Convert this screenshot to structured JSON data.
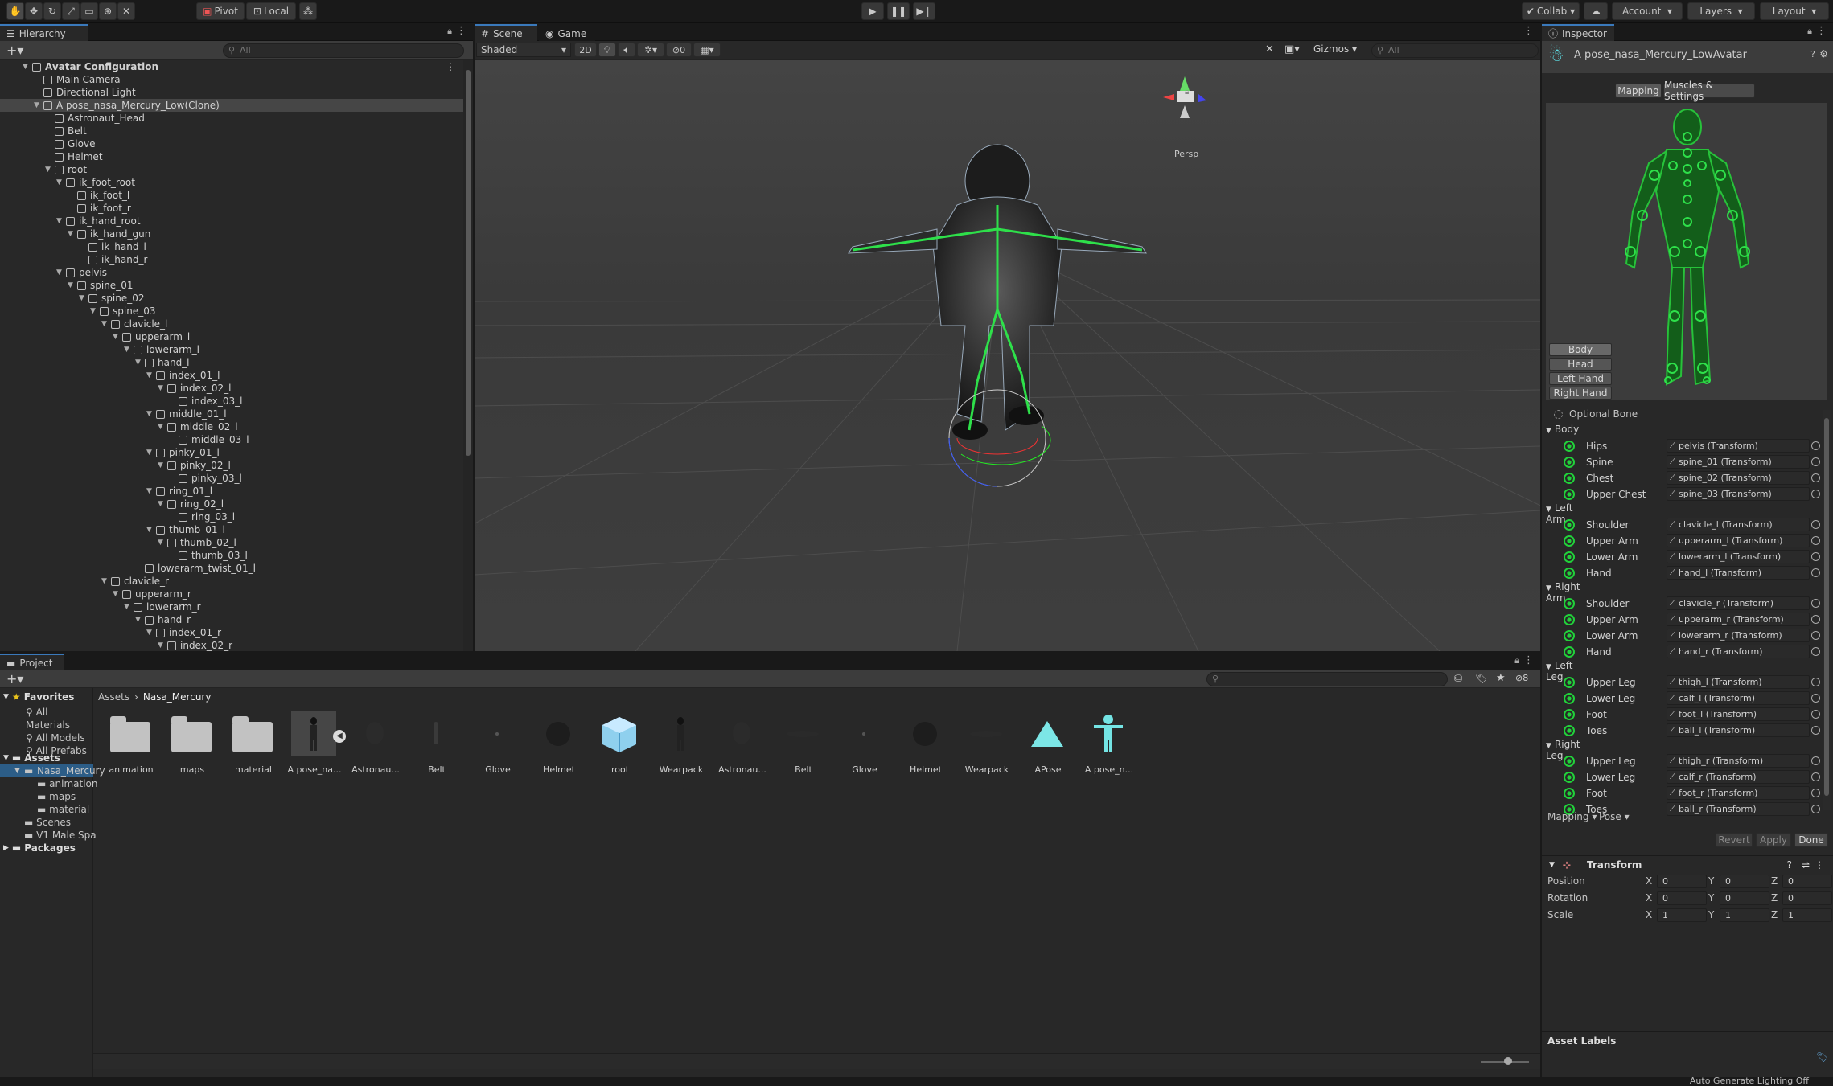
{
  "toolbar": {
    "pivot": "Pivot",
    "local": "Local",
    "collab": "Collab",
    "account": "Account",
    "layers": "Layers",
    "layout": "Layout"
  },
  "hierarchy": {
    "title": "Hierarchy",
    "search_placeholder": "All",
    "rows": [
      {
        "label": "Avatar Configuration",
        "depth": 0,
        "tri": "▼",
        "bold": true,
        "scene": true
      },
      {
        "label": "Main Camera",
        "depth": 1,
        "tri": ""
      },
      {
        "label": "Directional Light",
        "depth": 1,
        "tri": ""
      },
      {
        "label": "A pose_nasa_Mercury_Low(Clone)",
        "depth": 1,
        "tri": "▼",
        "selected": true
      },
      {
        "label": "Astronaut_Head",
        "depth": 2,
        "tri": ""
      },
      {
        "label": "Belt",
        "depth": 2,
        "tri": ""
      },
      {
        "label": "Glove",
        "depth": 2,
        "tri": ""
      },
      {
        "label": "Helmet",
        "depth": 2,
        "tri": ""
      },
      {
        "label": "root",
        "depth": 2,
        "tri": "▼"
      },
      {
        "label": "ik_foot_root",
        "depth": 3,
        "tri": "▼"
      },
      {
        "label": "ik_foot_l",
        "depth": 4,
        "tri": ""
      },
      {
        "label": "ik_foot_r",
        "depth": 4,
        "tri": ""
      },
      {
        "label": "ik_hand_root",
        "depth": 3,
        "tri": "▼"
      },
      {
        "label": "ik_hand_gun",
        "depth": 4,
        "tri": "▼"
      },
      {
        "label": "ik_hand_l",
        "depth": 5,
        "tri": ""
      },
      {
        "label": "ik_hand_r",
        "depth": 5,
        "tri": ""
      },
      {
        "label": "pelvis",
        "depth": 3,
        "tri": "▼"
      },
      {
        "label": "spine_01",
        "depth": 4,
        "tri": "▼"
      },
      {
        "label": "spine_02",
        "depth": 5,
        "tri": "▼"
      },
      {
        "label": "spine_03",
        "depth": 6,
        "tri": "▼"
      },
      {
        "label": "clavicle_l",
        "depth": 7,
        "tri": "▼"
      },
      {
        "label": "upperarm_l",
        "depth": 8,
        "tri": "▼"
      },
      {
        "label": "lowerarm_l",
        "depth": 9,
        "tri": "▼"
      },
      {
        "label": "hand_l",
        "depth": 10,
        "tri": "▼"
      },
      {
        "label": "index_01_l",
        "depth": 11,
        "tri": "▼"
      },
      {
        "label": "index_02_l",
        "depth": 12,
        "tri": "▼"
      },
      {
        "label": "index_03_l",
        "depth": 13,
        "tri": ""
      },
      {
        "label": "middle_01_l",
        "depth": 11,
        "tri": "▼"
      },
      {
        "label": "middle_02_l",
        "depth": 12,
        "tri": "▼"
      },
      {
        "label": "middle_03_l",
        "depth": 13,
        "tri": ""
      },
      {
        "label": "pinky_01_l",
        "depth": 11,
        "tri": "▼"
      },
      {
        "label": "pinky_02_l",
        "depth": 12,
        "tri": "▼"
      },
      {
        "label": "pinky_03_l",
        "depth": 13,
        "tri": ""
      },
      {
        "label": "ring_01_l",
        "depth": 11,
        "tri": "▼"
      },
      {
        "label": "ring_02_l",
        "depth": 12,
        "tri": "▼"
      },
      {
        "label": "ring_03_l",
        "depth": 13,
        "tri": ""
      },
      {
        "label": "thumb_01_l",
        "depth": 11,
        "tri": "▼"
      },
      {
        "label": "thumb_02_l",
        "depth": 12,
        "tri": "▼"
      },
      {
        "label": "thumb_03_l",
        "depth": 13,
        "tri": ""
      },
      {
        "label": "lowerarm_twist_01_l",
        "depth": 10,
        "tri": ""
      },
      {
        "label": "clavicle_r",
        "depth": 7,
        "tri": "▼"
      },
      {
        "label": "upperarm_r",
        "depth": 8,
        "tri": "▼"
      },
      {
        "label": "lowerarm_r",
        "depth": 9,
        "tri": "▼"
      },
      {
        "label": "hand_r",
        "depth": 10,
        "tri": "▼"
      },
      {
        "label": "index_01_r",
        "depth": 11,
        "tri": "▼"
      },
      {
        "label": "index_02_r",
        "depth": 12,
        "tri": "▼"
      }
    ]
  },
  "scene": {
    "tab_scene": "Scene",
    "tab_game": "Game",
    "shading": "Shaded",
    "mode2d": "2D",
    "hidden_count": "0",
    "gizmos": "Gizmos",
    "search_placeholder": "All",
    "persp": "Persp"
  },
  "project": {
    "title": "Project",
    "favorites": "Favorites",
    "fav_items": [
      "All Materials",
      "All Models",
      "All Prefabs"
    ],
    "assets": "Assets",
    "tree": [
      "Nasa_Mercury",
      "animation",
      "maps",
      "material",
      "Scenes",
      "V1 Male Spa"
    ],
    "packages": "Packages",
    "breadcrumb": [
      "Assets",
      "Nasa_Mercury"
    ],
    "hidden_count": "8",
    "items": [
      {
        "label": "animation",
        "kind": "folder"
      },
      {
        "label": "maps",
        "kind": "folder"
      },
      {
        "label": "material",
        "kind": "folder"
      },
      {
        "label": "A pose_na...",
        "kind": "figure",
        "selected": true
      },
      {
        "label": "Astronau...",
        "kind": "head"
      },
      {
        "label": "Belt",
        "kind": "small"
      },
      {
        "label": "Glove",
        "kind": "dot"
      },
      {
        "label": "Helmet",
        "kind": "ball"
      },
      {
        "label": "root",
        "kind": "box"
      },
      {
        "label": "Wearpack",
        "kind": "figure"
      },
      {
        "label": "Astronau...",
        "kind": "head"
      },
      {
        "label": "Belt",
        "kind": "flat"
      },
      {
        "label": "Glove",
        "kind": "dot"
      },
      {
        "label": "Helmet",
        "kind": "ball"
      },
      {
        "label": "Wearpack",
        "kind": "flat"
      },
      {
        "label": "APose",
        "kind": "apose"
      },
      {
        "label": "A pose_n...",
        "kind": "avatar"
      }
    ]
  },
  "inspector": {
    "title": "Inspector",
    "object_name": "A pose_nasa_Mercury_LowAvatar",
    "tab_mapping": "Mapping",
    "tab_muscles": "Muscles & Settings",
    "body_buttons": [
      "Body",
      "Head",
      "Left Hand",
      "Right Hand"
    ],
    "optional_bone": "Optional Bone",
    "groups": [
      {
        "name": "Body",
        "bones": [
          [
            "Hips",
            "pelvis (Transform)"
          ],
          [
            "Spine",
            "spine_01 (Transform)"
          ],
          [
            "Chest",
            "spine_02 (Transform)"
          ],
          [
            "Upper Chest",
            "spine_03 (Transform)"
          ]
        ]
      },
      {
        "name": "Left Arm",
        "bones": [
          [
            "Shoulder",
            "clavicle_l (Transform)"
          ],
          [
            "Upper Arm",
            "upperarm_l (Transform)"
          ],
          [
            "Lower Arm",
            "lowerarm_l (Transform)"
          ],
          [
            "Hand",
            "hand_l (Transform)"
          ]
        ]
      },
      {
        "name": "Right Arm",
        "bones": [
          [
            "Shoulder",
            "clavicle_r (Transform)"
          ],
          [
            "Upper Arm",
            "upperarm_r (Transform)"
          ],
          [
            "Lower Arm",
            "lowerarm_r (Transform)"
          ],
          [
            "Hand",
            "hand_r (Transform)"
          ]
        ]
      },
      {
        "name": "Left Leg",
        "bones": [
          [
            "Upper Leg",
            "thigh_l (Transform)"
          ],
          [
            "Lower Leg",
            "calf_l (Transform)"
          ],
          [
            "Foot",
            "foot_l (Transform)"
          ],
          [
            "Toes",
            "ball_l (Transform)"
          ]
        ]
      },
      {
        "name": "Right Leg",
        "bones": [
          [
            "Upper Leg",
            "thigh_r (Transform)"
          ],
          [
            "Lower Leg",
            "calf_r (Transform)"
          ],
          [
            "Foot",
            "foot_r (Transform)"
          ],
          [
            "Toes",
            "ball_r (Transform)"
          ]
        ]
      }
    ],
    "mapping_menu": "Mapping",
    "pose_menu": "Pose",
    "revert": "Revert",
    "apply": "Apply",
    "done": "Done",
    "transform": {
      "title": "Transform",
      "rows": [
        [
          "Position",
          "0",
          "0",
          "0"
        ],
        [
          "Rotation",
          "0",
          "0",
          "0"
        ],
        [
          "Scale",
          "1",
          "1",
          "1"
        ]
      ]
    },
    "asset_labels": "Asset Labels"
  },
  "status": {
    "text": "Auto Generate Lighting Off"
  },
  "colors": {
    "accent": "#3a79bb",
    "bone_green": "#21d23a"
  }
}
